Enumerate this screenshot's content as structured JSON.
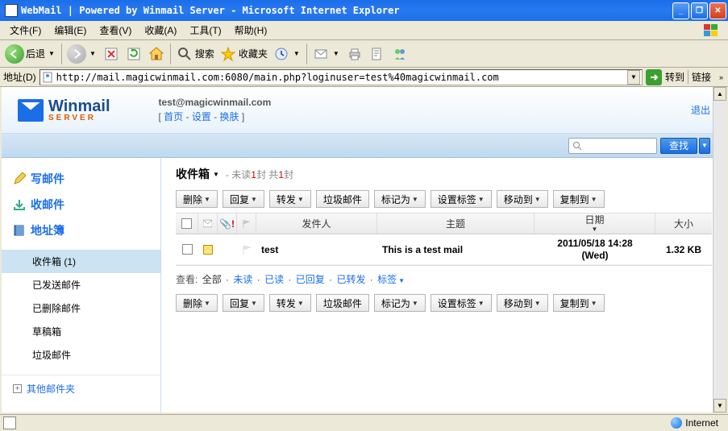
{
  "window": {
    "title": "WebMail | Powered by Winmail Server - Microsoft Internet Explorer"
  },
  "menu": {
    "file": "文件(F)",
    "edit": "编辑(E)",
    "view": "查看(V)",
    "fav": "收藏(A)",
    "tools": "工具(T)",
    "help": "帮助(H)"
  },
  "toolbar": {
    "back": "后退",
    "search": "搜索",
    "favorites": "收藏夹"
  },
  "addressbar": {
    "label": "地址(D)",
    "url": "http://mail.magicwinmail.com:6080/main.php?loginuser=test%40magicwinmail.com",
    "go": "转到",
    "links": "链接"
  },
  "header": {
    "logo1": "Winmail",
    "logo2": "SERVER",
    "email": "test@magicwinmail.com",
    "nav_home": "首页",
    "nav_settings": "设置",
    "nav_skin": "换肤",
    "logout": "退出"
  },
  "search": {
    "button": "查找"
  },
  "sidebar": {
    "compose": "写邮件",
    "receive": "收邮件",
    "contacts": "地址簿",
    "folders": {
      "inbox": "收件箱 (1)",
      "sent": "已发送邮件",
      "trash": "已删除邮件",
      "drafts": "草稿箱",
      "spam": "垃圾邮件"
    },
    "other": "其他邮件夹"
  },
  "main": {
    "title": "收件箱",
    "info_prefix": "未读",
    "info_val1": "1",
    "info_mid": "封 共",
    "info_val2": "1",
    "info_suffix": "封",
    "buttons": {
      "delete": "删除",
      "reply": "回复",
      "forward": "转发",
      "spam": "垃圾邮件",
      "mark": "标记为",
      "tag": "设置标签",
      "move": "移动到",
      "copy": "复制到"
    },
    "columns": {
      "from": "发件人",
      "subject": "主题",
      "date": "日期",
      "size": "大小"
    },
    "row": {
      "from": "test",
      "subject": "This is a test mail",
      "date1": "2011/05/18 14:28",
      "date2": "(Wed)",
      "size": "1.32 KB"
    },
    "filters": {
      "label": "查看:",
      "all": "全部",
      "unread": "未读",
      "read": "已读",
      "replied": "已回复",
      "forwarded": "已转发",
      "tags": "标签"
    }
  },
  "status": {
    "zone": "Internet"
  }
}
